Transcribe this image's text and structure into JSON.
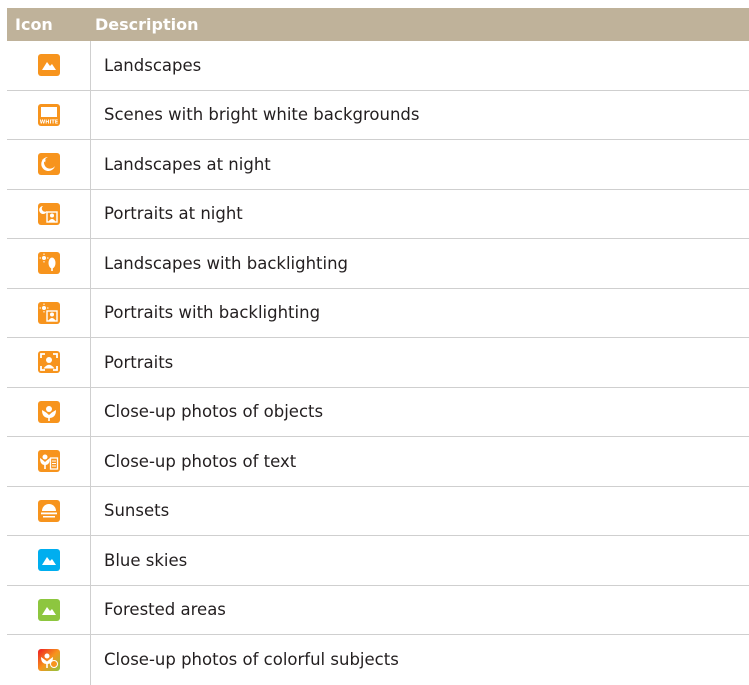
{
  "table": {
    "headers": {
      "icon": "Icon",
      "description": "Description"
    },
    "rows": [
      {
        "icon": "landscape-icon",
        "color": "#f7941d",
        "description": "Landscapes"
      },
      {
        "icon": "white-background-icon",
        "color": "#f7941d",
        "description": "Scenes with bright white backgrounds",
        "icon_text": "WHITE"
      },
      {
        "icon": "night-landscape-icon",
        "color": "#f7941d",
        "description": "Landscapes at night"
      },
      {
        "icon": "night-portrait-icon",
        "color": "#f7941d",
        "description": "Portraits at night"
      },
      {
        "icon": "backlight-landscape-icon",
        "color": "#f7941d",
        "description": "Landscapes with backlighting"
      },
      {
        "icon": "backlight-portrait-icon",
        "color": "#f7941d",
        "description": "Portraits with backlighting"
      },
      {
        "icon": "portrait-icon",
        "color": "#f7941d",
        "description": "Portraits"
      },
      {
        "icon": "macro-icon",
        "color": "#f7941d",
        "description": "Close-up photos of objects"
      },
      {
        "icon": "macro-text-icon",
        "color": "#f7941d",
        "description": "Close-up photos of text"
      },
      {
        "icon": "sunset-icon",
        "color": "#f7941d",
        "description": "Sunsets"
      },
      {
        "icon": "blue-sky-icon",
        "color": "#00aeef",
        "description": "Blue skies"
      },
      {
        "icon": "forest-icon",
        "color": "#8dc63f",
        "description": "Forested areas"
      },
      {
        "icon": "macro-color-icon",
        "color": "#f7941d",
        "description": "Close-up photos of colorful subjects"
      }
    ]
  }
}
